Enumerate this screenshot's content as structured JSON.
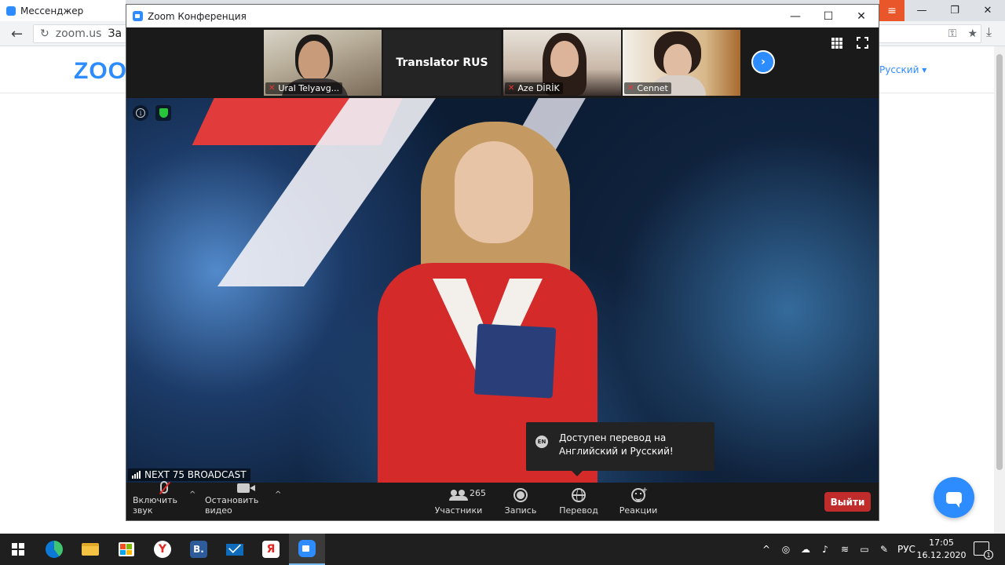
{
  "browser": {
    "tab_title": "Мессенджер",
    "url": "zoom.us",
    "url_rest": "За",
    "page_lang": "Русский ▾",
    "page_logo": "ZOO",
    "menu_icon": "≡"
  },
  "zoom": {
    "window_title": "Zoom Конференция",
    "participants": [
      {
        "name": "Ural Telyavg..."
      },
      {
        "name": "Translator RUS"
      },
      {
        "name": "Aze DİRİK"
      },
      {
        "name": "Cennet"
      }
    ],
    "speaker_label": "NEXT 75  BROADCAST",
    "toast": {
      "badge": "EN",
      "text": "Доступен перевод на Английский и Русский!"
    },
    "toolbar": {
      "mute_label": "Включить звук",
      "video_label": "Остановить видео",
      "participants_label": "Участники",
      "participants_count": "265",
      "record_label": "Запись",
      "translate_label": "Перевод",
      "reactions_label": "Реакции",
      "leave_label": "Выйти"
    }
  },
  "taskbar": {
    "apps": [
      "windows-start",
      "edge",
      "file-explorer",
      "store",
      "yandex-browser",
      "vk",
      "mail",
      "yandex",
      "zoom"
    ],
    "lang": "РУС",
    "time": "17:05",
    "date": "16.12.2020",
    "notifications": "1"
  },
  "colors": {
    "zoom_blue": "#2d8cff",
    "leave_red": "#c02c2c",
    "taskbar": "#1f1f1f"
  }
}
